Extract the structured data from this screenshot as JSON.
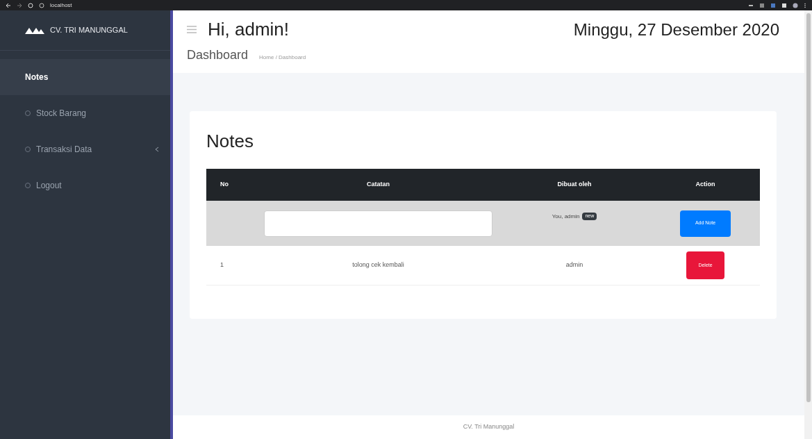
{
  "browser": {
    "address": "localhost"
  },
  "sidebar": {
    "brand": "CV. TRI MANUNGGAL",
    "items": [
      {
        "label": "Notes",
        "selected": true,
        "expandable": false
      },
      {
        "label": "Stock Barang",
        "selected": false,
        "expandable": false
      },
      {
        "label": "Transaksi Data",
        "selected": false,
        "expandable": true
      },
      {
        "label": "Logout",
        "selected": false,
        "expandable": false
      }
    ]
  },
  "header": {
    "greeting": "Hi, admin!",
    "date": "Minggu, 27 Desember 2020",
    "page_title": "Dashboard",
    "breadcrumb": "Home / Dashboard"
  },
  "card": {
    "title": "Notes",
    "table": {
      "columns": [
        "No",
        "Catatan",
        "Dibuat oleh",
        "Action"
      ],
      "new_row": {
        "author": "You, admin",
        "badge": "new",
        "button": "Add Note"
      },
      "rows": [
        {
          "no": "1",
          "note": "tolong cek kembali",
          "author": "admin",
          "button": "Delete"
        }
      ]
    }
  },
  "footer": "CV. Tri Manunggal"
}
